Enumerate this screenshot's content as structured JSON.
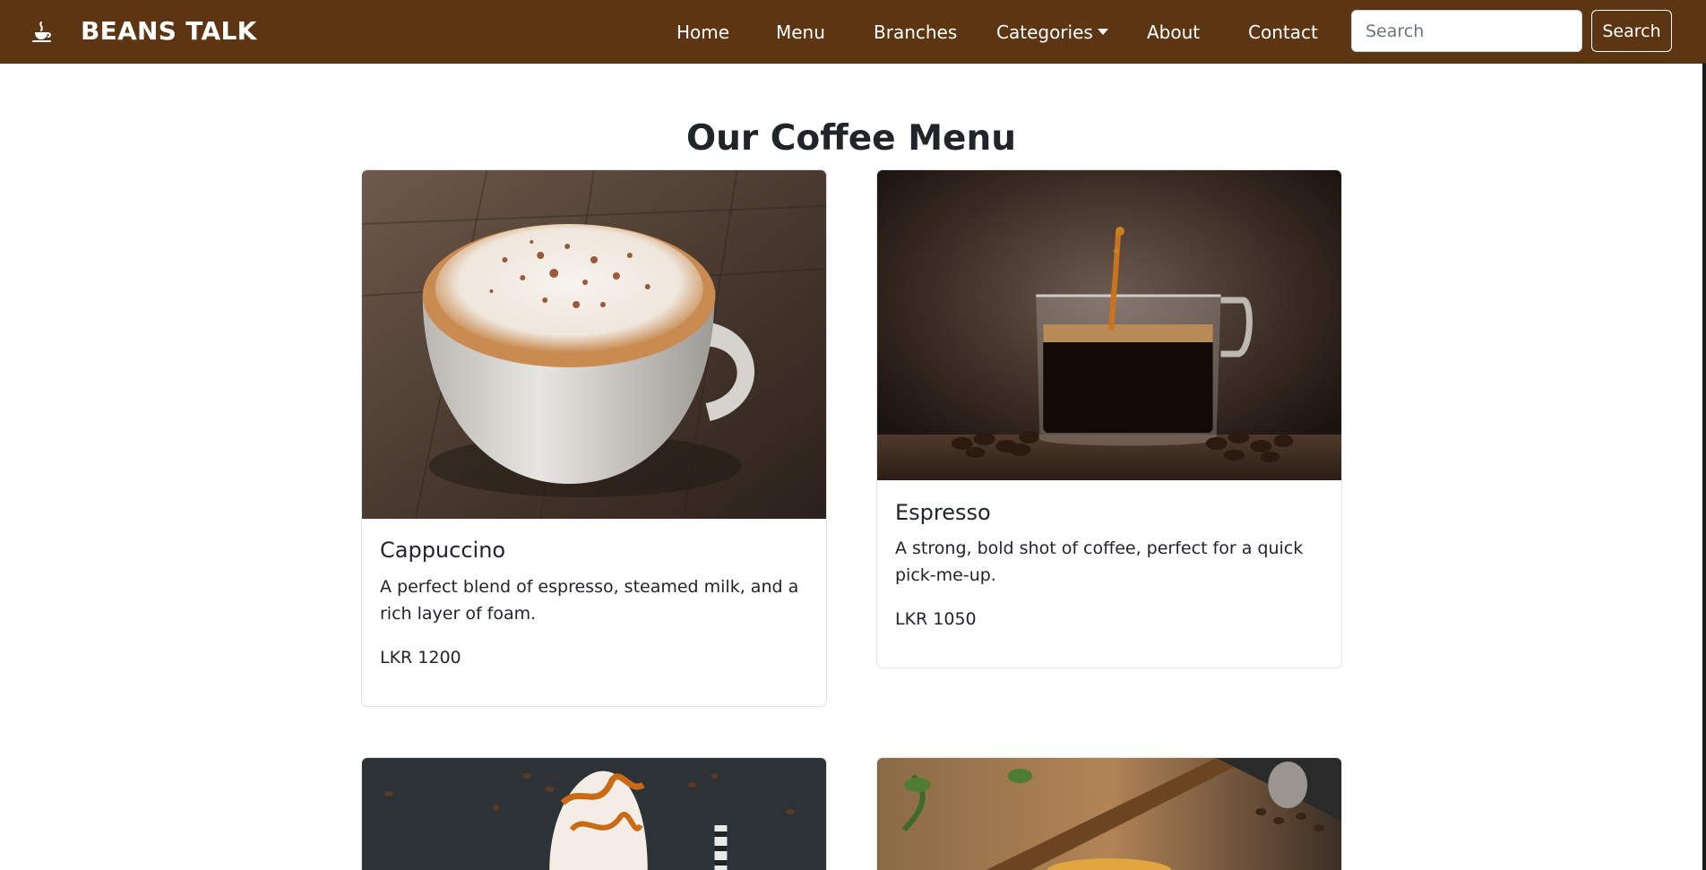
{
  "brand": {
    "name": "BEANS TALK",
    "icon": "coffee-cup-icon"
  },
  "nav": {
    "items": [
      {
        "label": "Home"
      },
      {
        "label": "Menu"
      },
      {
        "label": "Branches"
      },
      {
        "label": "Categories",
        "dropdown": true
      },
      {
        "label": "About"
      },
      {
        "label": "Contact"
      }
    ],
    "search_placeholder": "Search",
    "search_button": "Search"
  },
  "page": {
    "title": "Our Coffee Menu"
  },
  "menu_items": [
    {
      "name": "Cappuccino",
      "description": "A perfect blend of espresso, steamed milk, and a rich layer of foam.",
      "price": "LKR 1200"
    },
    {
      "name": "Espresso",
      "description": "A strong, bold shot of coffee, perfect for a quick pick-me-up.",
      "price": "LKR 1050"
    }
  ],
  "colors": {
    "navbar": "#5c3512",
    "text": "#212529",
    "border": "#dee2e6"
  }
}
